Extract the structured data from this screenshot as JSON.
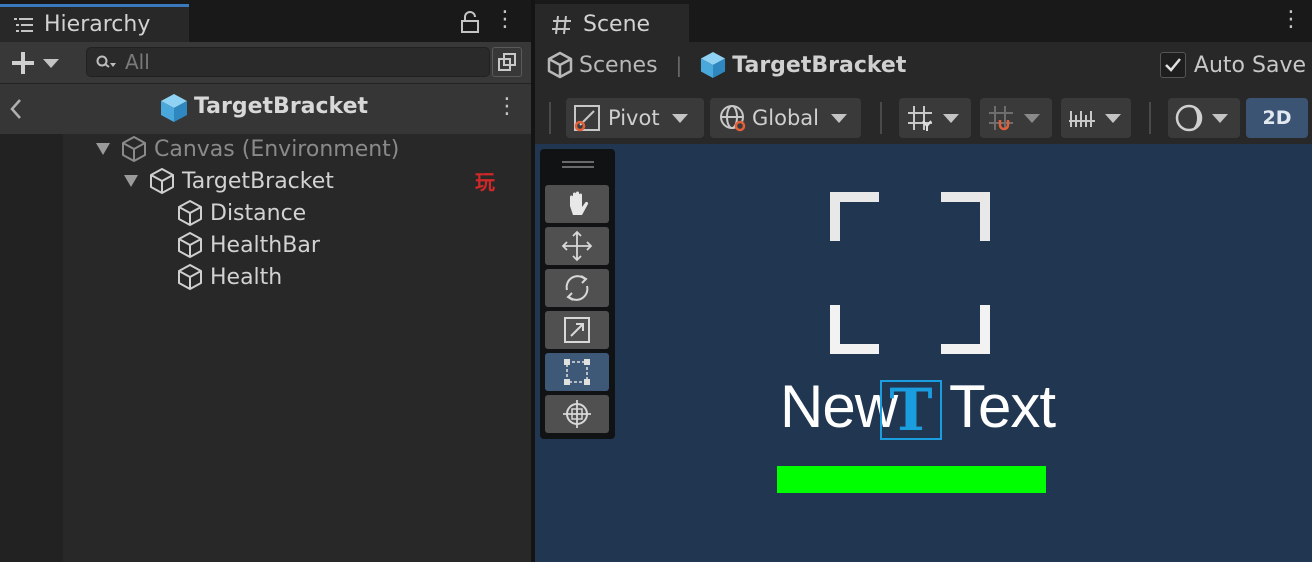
{
  "hierarchy": {
    "tab_label": "Hierarchy",
    "search_placeholder": "All",
    "scene_title": "TargetBracket",
    "tree": [
      {
        "label": "Canvas (Environment)",
        "muted": true
      },
      {
        "label": "TargetBracket"
      },
      {
        "label": "Distance"
      },
      {
        "label": "HealthBar"
      },
      {
        "label": "Health"
      }
    ],
    "badge_glyph": "玩"
  },
  "scene": {
    "tab_label": "Scene",
    "breadcrumb_scenes": "Scenes",
    "breadcrumb_separator": "|",
    "breadcrumb_target": "TargetBracket",
    "autosave_label": "Auto Save",
    "autosave_checked": true,
    "pivot_label": "Pivot",
    "global_label": "Global",
    "mode_2d_label": "2D",
    "viewport": {
      "text_left": "New",
      "text_right": "Text",
      "gizmo_glyph": "T"
    }
  },
  "colors": {
    "accent_tab": "#3a79bb",
    "viewport_bg": "#213650",
    "health_fill": "#00ff00",
    "gizmo": "#1a9ee0",
    "badge": "#d02828"
  },
  "icons": [
    "list-icon",
    "lock-icon",
    "more-icon",
    "plus-icon",
    "search-icon",
    "scene-hierarchy-icon",
    "back-chevron-icon",
    "unity-cube-icon",
    "gameobject-icon",
    "hash-icon",
    "pivot-icon",
    "globe-icon",
    "grid-snap-icon",
    "increment-snap-icon",
    "ruler-icon",
    "shading-icon",
    "hand-icon",
    "move-icon",
    "rotate-icon",
    "scale-icon",
    "rect-icon",
    "transform-icon"
  ]
}
